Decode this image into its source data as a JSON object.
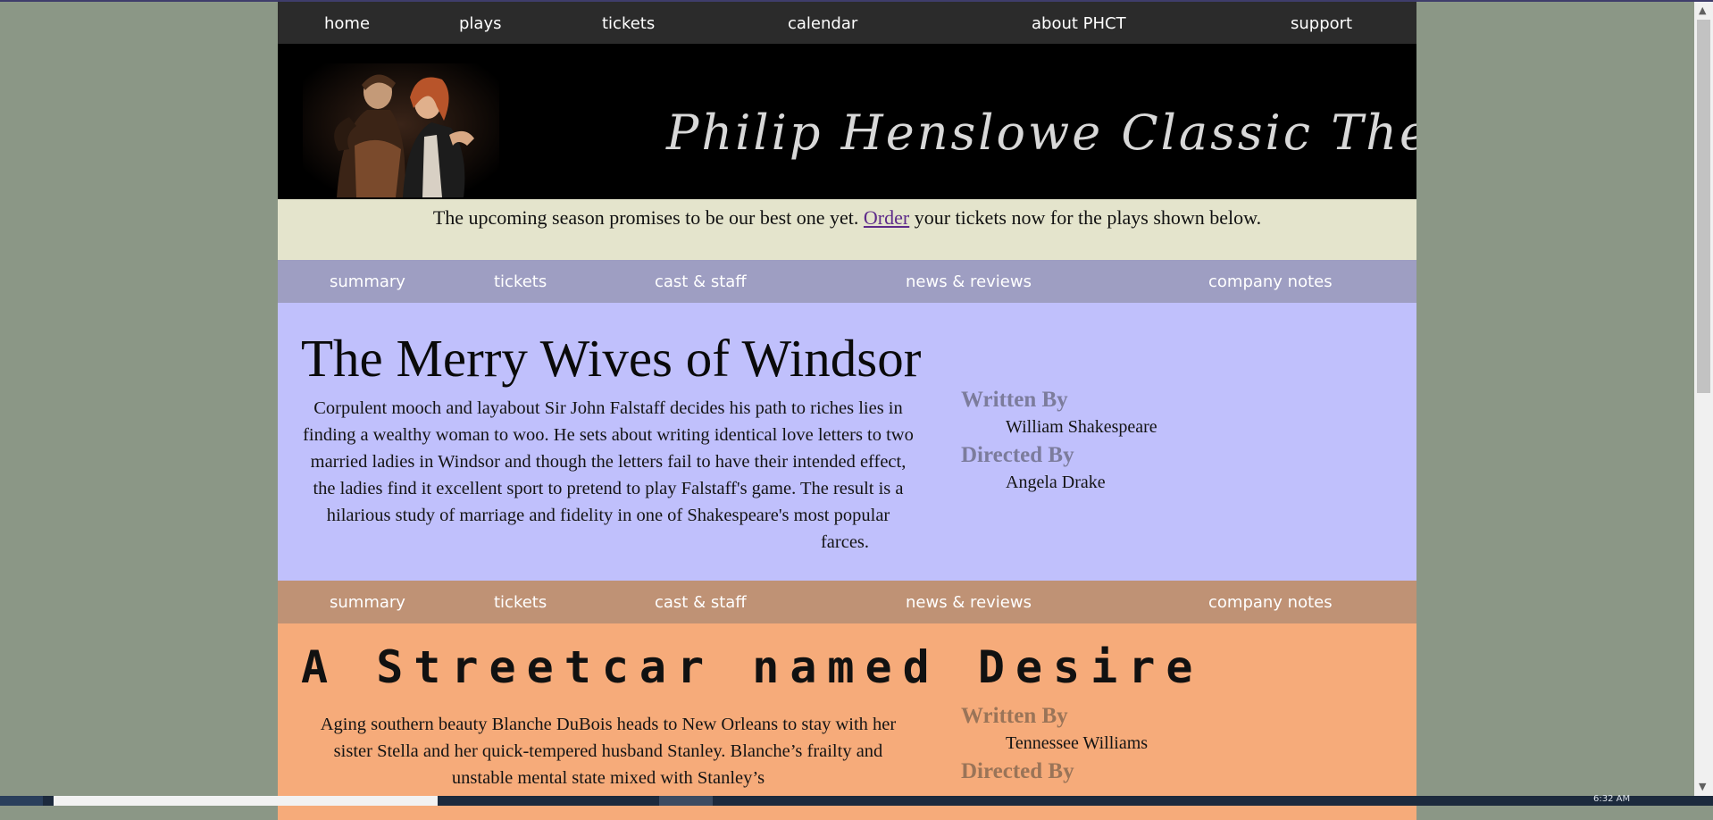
{
  "main_nav": [
    "home",
    "plays",
    "tickets",
    "calendar",
    "about PHCT",
    "support"
  ],
  "banner": {
    "title": "Philip Henslowe Classic Theatre"
  },
  "announcement": {
    "before": "The upcoming season promises to be our best one yet. ",
    "link": "Order",
    "after": " your tickets now for the plays shown below."
  },
  "plays": [
    {
      "tabs": [
        "summary",
        "tickets",
        "cast & staff",
        "news & reviews",
        "company notes"
      ],
      "title": "The Merry Wives of Windsor",
      "summary": "Corpulent mooch and layabout Sir John Falstaff decides his path to riches lies in finding a wealthy woman to woo. He sets about writing identical love letters to two married ladies in Windsor and though the letters fail to have their intended effect, the ladies find it excellent sport to pretend to play Falstaff's game. The result is a hilarious study of marriage and fidelity in one of Shakespeare's most popular farces.",
      "written_by_label": "Written By",
      "written_by": "William Shakespeare",
      "directed_by_label": "Directed By",
      "directed_by": "Angela Drake"
    },
    {
      "tabs": [
        "summary",
        "tickets",
        "cast & staff",
        "news & reviews",
        "company notes"
      ],
      "title": "A Streetcar named Desire",
      "summary": "Aging southern beauty Blanche DuBois heads to New Orleans to stay with her sister Stella and her quick-tempered husband Stanley. Blanche’s frailty and unstable mental state mixed with Stanley’s",
      "written_by_label": "Written By",
      "written_by": "Tennessee Williams",
      "directed_by_label": "Directed By"
    }
  ],
  "taskbar": {
    "time": "6:32 AM"
  },
  "colors": {
    "page_background": "#8b9786",
    "nav_background": "#2b2b2b",
    "announcement_background": "#e4e4cc",
    "merry_tabs": "#9e9ec2",
    "merry_panel": "#c0c0fc",
    "streetcar_tabs": "#bf9275",
    "streetcar_panel": "#f6ab7a",
    "link": "#5e2b8a"
  }
}
